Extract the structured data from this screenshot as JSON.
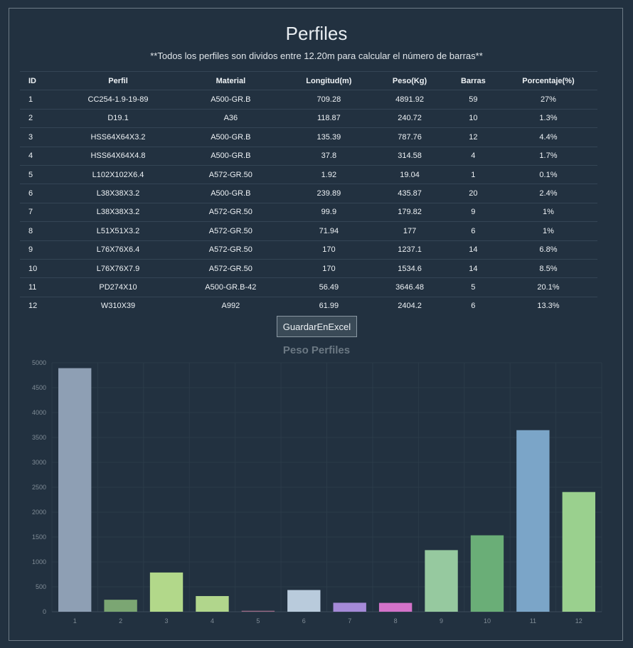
{
  "title": "Perfiles",
  "subtitle": "**Todos los perfiles son dividos entre 12.20m para calcular el número de barras**",
  "table": {
    "headers": [
      "ID",
      "Perfil",
      "Material",
      "Longitud(m)",
      "Peso(Kg)",
      "Barras",
      "Porcentaje(%)"
    ],
    "rows": [
      [
        "1",
        "CC254-1.9-19-89",
        "A500-GR.B",
        "709.28",
        "4891.92",
        "59",
        "27%"
      ],
      [
        "2",
        "D19.1",
        "A36",
        "118.87",
        "240.72",
        "10",
        "1.3%"
      ],
      [
        "3",
        "HSS64X64X3.2",
        "A500-GR.B",
        "135.39",
        "787.76",
        "12",
        "4.4%"
      ],
      [
        "4",
        "HSS64X64X4.8",
        "A500-GR.B",
        "37.8",
        "314.58",
        "4",
        "1.7%"
      ],
      [
        "5",
        "L102X102X6.4",
        "A572-GR.50",
        "1.92",
        "19.04",
        "1",
        "0.1%"
      ],
      [
        "6",
        "L38X38X3.2",
        "A500-GR.B",
        "239.89",
        "435.87",
        "20",
        "2.4%"
      ],
      [
        "7",
        "L38X38X3.2",
        "A572-GR.50",
        "99.9",
        "179.82",
        "9",
        "1%"
      ],
      [
        "8",
        "L51X51X3.2",
        "A572-GR.50",
        "71.94",
        "177",
        "6",
        "1%"
      ],
      [
        "9",
        "L76X76X6.4",
        "A572-GR.50",
        "170",
        "1237.1",
        "14",
        "6.8%"
      ],
      [
        "10",
        "L76X76X7.9",
        "A572-GR.50",
        "170",
        "1534.6",
        "14",
        "8.5%"
      ],
      [
        "11",
        "PD274X10",
        "A500-GR.B-42",
        "56.49",
        "3646.48",
        "5",
        "20.1%"
      ],
      [
        "12",
        "W310X39",
        "A992",
        "61.99",
        "2404.2",
        "6",
        "13.3%"
      ]
    ]
  },
  "button_label": "GuardarEnExcel",
  "chart_data": {
    "type": "bar",
    "title": "Peso Perfiles",
    "categories": [
      "1",
      "2",
      "3",
      "4",
      "5",
      "6",
      "7",
      "8",
      "9",
      "10",
      "11",
      "12"
    ],
    "values": [
      4891.92,
      240.72,
      787.76,
      314.58,
      19.04,
      435.87,
      179.82,
      177,
      1237.1,
      1534.6,
      3646.48,
      2404.2
    ],
    "colors": [
      "#8e9fb4",
      "#7ba673",
      "#b2d88a",
      "#b1d68c",
      "#9a6a86",
      "#b9cbdc",
      "#a58ad8",
      "#d372c9",
      "#96c99f",
      "#6aae77",
      "#7ba5c8",
      "#9ad08e"
    ],
    "ylim": [
      0,
      5000
    ],
    "yticks": [
      0,
      500,
      1000,
      1500,
      2000,
      2500,
      3000,
      3500,
      4000,
      4500,
      5000
    ],
    "grid": true,
    "legend": false
  }
}
